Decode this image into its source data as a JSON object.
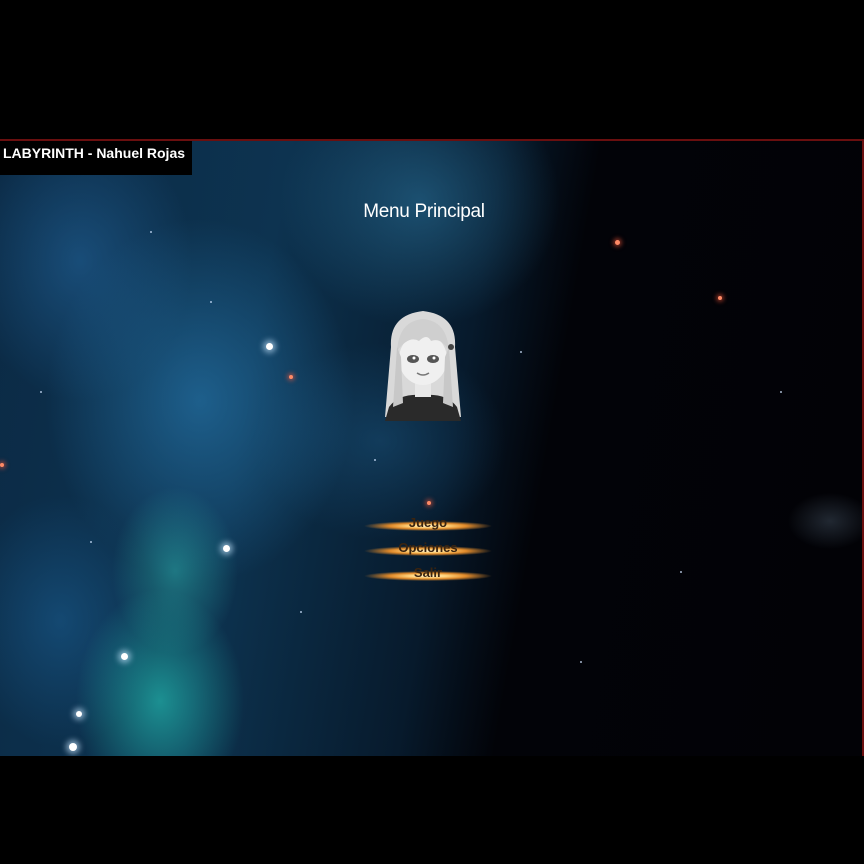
{
  "window": {
    "title": "LABYRINTH - Nahuel Rojas"
  },
  "menu": {
    "title": "Menu Principal",
    "buttons": [
      {
        "label": "Juego"
      },
      {
        "label": "Opciones"
      },
      {
        "label": "Salir"
      }
    ]
  },
  "colors": {
    "border": "#6a0f0f",
    "nebula_blue": "#0d3350",
    "nebula_cyan": "#28dcc8",
    "button_glow": "#ffd27a",
    "button_text": "#3a2410"
  },
  "icons": {
    "avatar": "anime-girl-portrait"
  }
}
